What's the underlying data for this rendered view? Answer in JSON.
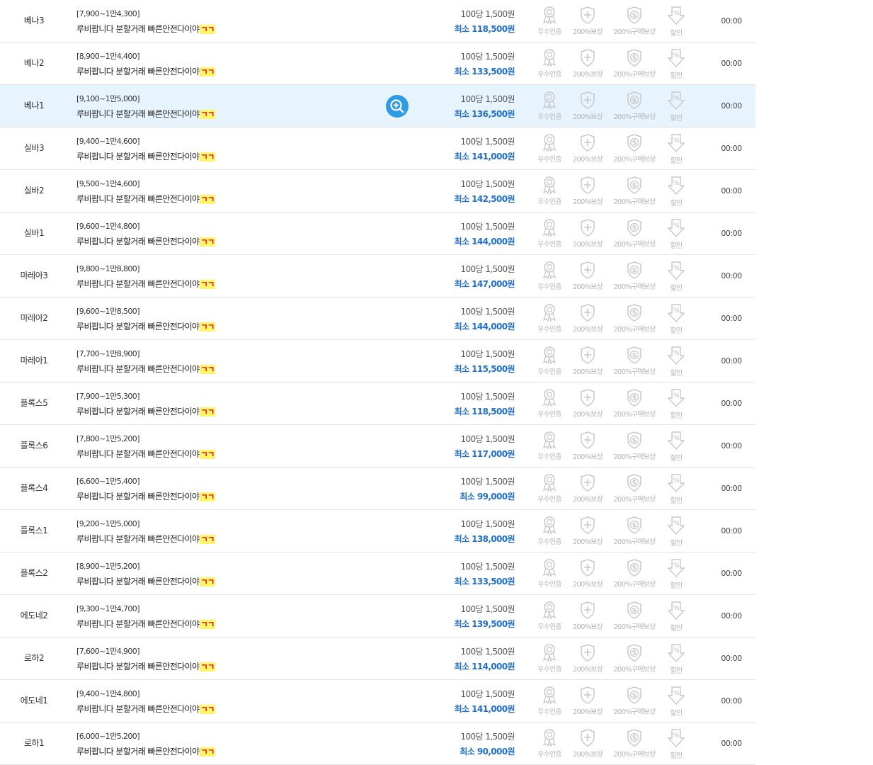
{
  "search_icon": "magnify-plus-icon",
  "colors": {
    "accent_blue": "#1e6fcf",
    "highlight_row": "#e8f4fd",
    "marker_bg": "#fff56b",
    "marker_text": "#e60012"
  },
  "listings": [
    {
      "server": "베나3",
      "range": "[7,900~1만4,300]",
      "title": "루비팝니다 분할거래 빠른안전다이야",
      "mark": "ㄱㄱ",
      "unit_price": "100당 1,500원",
      "min_price": "최소 118,500원",
      "badges": [
        "우수인증",
        "200%보상",
        "200%구매보상",
        "할인"
      ],
      "time": "00:00"
    },
    {
      "server": "베나2",
      "range": "[8,900~1만4,400]",
      "title": "루비팝니다 분할거래 빠른안전다이야",
      "mark": "ㄱㄱ",
      "unit_price": "100당 1,500원",
      "min_price": "최소 133,500원",
      "badges": [
        "우수인증",
        "200%보상",
        "200%구매보상",
        "할인"
      ],
      "time": "00:00"
    },
    {
      "server": "베나1",
      "range": "[9,100~1만5,000]",
      "title": "루비팝니다 분할거래 빠른안전다이야",
      "mark": "ㄱㄱ",
      "unit_price": "100당 1,500원",
      "min_price": "최소 136,500원",
      "badges": [
        "우수인증",
        "200%보상",
        "200%구매보상",
        "할인"
      ],
      "time": "00:00"
    },
    {
      "server": "실바3",
      "range": "[9,400~1만4,600]",
      "title": "루비팝니다 분할거래 빠른안전다이야",
      "mark": "ㄱㄱ",
      "unit_price": "100당 1,500원",
      "min_price": "최소 141,000원",
      "badges": [
        "우수인증",
        "200%보상",
        "200%구매보상",
        "할인"
      ],
      "time": "00:00"
    },
    {
      "server": "실바2",
      "range": "[9,500~1만4,600]",
      "title": "루비팝니다 분할거래 빠른안전다이야",
      "mark": "ㄱㄱ",
      "unit_price": "100당 1,500원",
      "min_price": "최소 142,500원",
      "badges": [
        "우수인증",
        "200%보상",
        "200%구매보상",
        "할인"
      ],
      "time": "00:00"
    },
    {
      "server": "실바1",
      "range": "[9,600~1만4,800]",
      "title": "루비팝니다 분할거래 빠른안전다이야",
      "mark": "ㄱㄱ",
      "unit_price": "100당 1,500원",
      "min_price": "최소 144,000원",
      "badges": [
        "우수인증",
        "200%보상",
        "200%구매보상",
        "할인"
      ],
      "time": "00:00"
    },
    {
      "server": "마레아3",
      "range": "[9,800~1만8,800]",
      "title": "루비팝니다 분할거래 빠른안전다이야",
      "mark": "ㄱㄱ",
      "unit_price": "100당 1,500원",
      "min_price": "최소 147,000원",
      "badges": [
        "우수인증",
        "200%보상",
        "200%구매보상",
        "할인"
      ],
      "time": "00:00"
    },
    {
      "server": "마레아2",
      "range": "[9,600~1만8,500]",
      "title": "루비팝니다 분할거래 빠른안전다이야",
      "mark": "ㄱㄱ",
      "unit_price": "100당 1,500원",
      "min_price": "최소 144,000원",
      "badges": [
        "우수인증",
        "200%보상",
        "200%구매보상",
        "할인"
      ],
      "time": "00:00"
    },
    {
      "server": "마레아1",
      "range": "[7,700~1만8,900]",
      "title": "루비팝니다 분할거래 빠른안전다이야",
      "mark": "ㄱㄱ",
      "unit_price": "100당 1,500원",
      "min_price": "최소 115,500원",
      "badges": [
        "우수인증",
        "200%보상",
        "200%구매보상",
        "할인"
      ],
      "time": "00:00"
    },
    {
      "server": "플록스5",
      "range": "[7,900~1만5,300]",
      "title": "루비팝니다 분할거래 빠른안전다이야",
      "mark": "ㄱㄱ",
      "unit_price": "100당 1,500원",
      "min_price": "최소 118,500원",
      "badges": [
        "우수인증",
        "200%보상",
        "200%구매보상",
        "할인"
      ],
      "time": "00:00"
    },
    {
      "server": "플록스6",
      "range": "[7,800~1만5,200]",
      "title": "루비팝니다 분할거래 빠른안전다이야",
      "mark": "ㄱㄱ",
      "unit_price": "100당 1,500원",
      "min_price": "최소 117,000원",
      "badges": [
        "우수인증",
        "200%보상",
        "200%구매보상",
        "할인"
      ],
      "time": "00:00"
    },
    {
      "server": "플록스4",
      "range": "[6,600~1만5,400]",
      "title": "루비팝니다 분할거래 빠른안전다이야",
      "mark": "ㄱㄱ",
      "unit_price": "100당 1,500원",
      "min_price": "최소 99,000원",
      "badges": [
        "우수인증",
        "200%보상",
        "200%구매보상",
        "할인"
      ],
      "time": "00:00"
    },
    {
      "server": "플록스1",
      "range": "[9,200~1만5,000]",
      "title": "루비팝니다 분할거래 빠른안전다이야",
      "mark": "ㄱㄱ",
      "unit_price": "100당 1,500원",
      "min_price": "최소 138,000원",
      "badges": [
        "우수인증",
        "200%보상",
        "200%구매보상",
        "할인"
      ],
      "time": "00:00"
    },
    {
      "server": "플록스2",
      "range": "[8,900~1만5,200]",
      "title": "루비팝니다 분할거래 빠른안전다이야",
      "mark": "ㄱㄱ",
      "unit_price": "100당 1,500원",
      "min_price": "최소 133,500원",
      "badges": [
        "우수인증",
        "200%보상",
        "200%구매보상",
        "할인"
      ],
      "time": "00:00"
    },
    {
      "server": "에도네2",
      "range": "[9,300~1만4,700]",
      "title": "루비팝니다 분할거래 빠른안전다이야",
      "mark": "ㄱㄱ",
      "unit_price": "100당 1,500원",
      "min_price": "최소 139,500원",
      "badges": [
        "우수인증",
        "200%보상",
        "200%구매보상",
        "할인"
      ],
      "time": "00:00"
    },
    {
      "server": "로하2",
      "range": "[7,600~1만4,900]",
      "title": "루비팝니다 분할거래 빠른안전다이야",
      "mark": "ㄱㄱ",
      "unit_price": "100당 1,500원",
      "min_price": "최소 114,000원",
      "badges": [
        "우수인증",
        "200%보상",
        "200%구매보상",
        "할인"
      ],
      "time": "00:00"
    },
    {
      "server": "에도네1",
      "range": "[9,400~1만4,800]",
      "title": "루비팝니다 분할거래 빠른안전다이야",
      "mark": "ㄱㄱ",
      "unit_price": "100당 1,500원",
      "min_price": "최소 141,000원",
      "badges": [
        "우수인증",
        "200%보상",
        "200%구매보상",
        "할인"
      ],
      "time": "00:00"
    },
    {
      "server": "로하1",
      "range": "[6,000~1만5,200]",
      "title": "루비팝니다 분할거래 빠른안전다이야",
      "mark": "ㄱㄱ",
      "unit_price": "100당 1,500원",
      "min_price": "최소 90,000원",
      "badges": [
        "우수인증",
        "200%보상",
        "200%구매보상",
        "할인"
      ],
      "time": "00:00"
    }
  ],
  "highlighted_index": 2
}
